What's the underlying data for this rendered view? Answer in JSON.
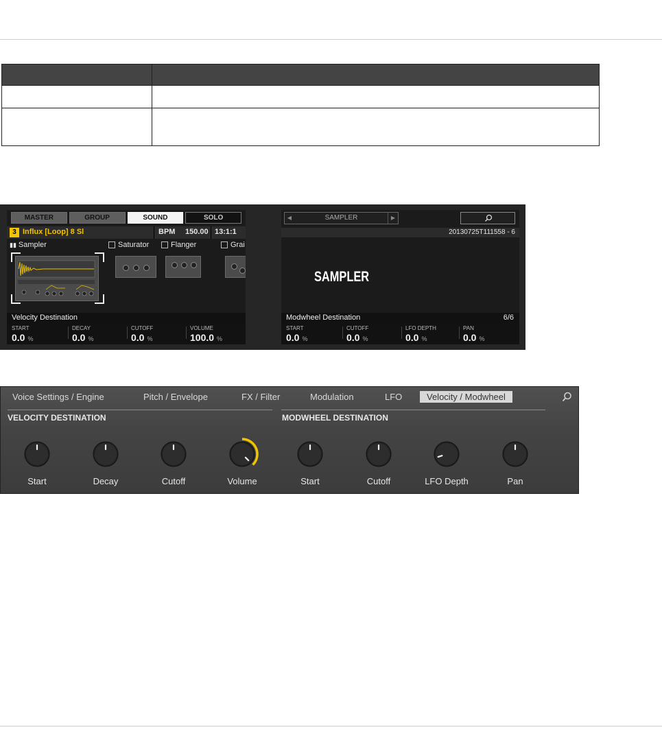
{
  "table": {
    "rows": 3
  },
  "hardware": {
    "tabs": [
      "MASTER",
      "GROUP",
      "SOUND",
      "SOLO"
    ],
    "sound_slot": "3",
    "sound_name": "Influx [Loop] 8 Sl",
    "bpm_label": "BPM",
    "bpm_value": "150.00",
    "position": "13:1:1",
    "plugins": [
      "Sampler",
      "Saturator",
      "Flanger",
      "Grai"
    ],
    "left_page_title": "Velocity Destination",
    "left_params": [
      {
        "label": "START",
        "value": "0.0",
        "unit": "%"
      },
      {
        "label": "DECAY",
        "value": "0.0",
        "unit": "%"
      },
      {
        "label": "CUTOFF",
        "value": "0.0",
        "unit": "%"
      },
      {
        "label": "VOLUME",
        "value": "100.0",
        "unit": "%"
      }
    ],
    "browser_label": "SAMPLER",
    "sample_name": "20130725T111558 - 6",
    "logo_text": "SAMPLER",
    "right_page_title": "Modwheel Destination",
    "right_page_count": "6/6",
    "right_params": [
      {
        "label": "START",
        "value": "0.0",
        "unit": "%"
      },
      {
        "label": "CUTOFF",
        "value": "0.0",
        "unit": "%"
      },
      {
        "label": "LFO DEPTH",
        "value": "0.0",
        "unit": "%"
      },
      {
        "label": "PAN",
        "value": "0.0",
        "unit": "%"
      }
    ]
  },
  "software": {
    "tabs": [
      "Voice Settings / Engine",
      "Pitch / Envelope",
      "FX / Filter",
      "Modulation",
      "LFO",
      "Velocity / Modwheel"
    ],
    "selected_tab": "Velocity / Modwheel",
    "sections": [
      "VELOCITY DESTINATION",
      "MODWHEEL DESTINATION"
    ],
    "knobs": [
      {
        "label": "Start",
        "level": 0.5
      },
      {
        "label": "Decay",
        "level": 0.5
      },
      {
        "label": "Cutoff",
        "level": 0.5
      },
      {
        "label": "Volume",
        "level": 1.0
      },
      {
        "label": "Start",
        "level": 0.5
      },
      {
        "label": "Cutoff",
        "level": 0.5
      },
      {
        "label": "LFO Depth",
        "level": 0.1
      },
      {
        "label": "Pan",
        "level": 0.5
      }
    ],
    "accent_color": "#f2c500"
  }
}
